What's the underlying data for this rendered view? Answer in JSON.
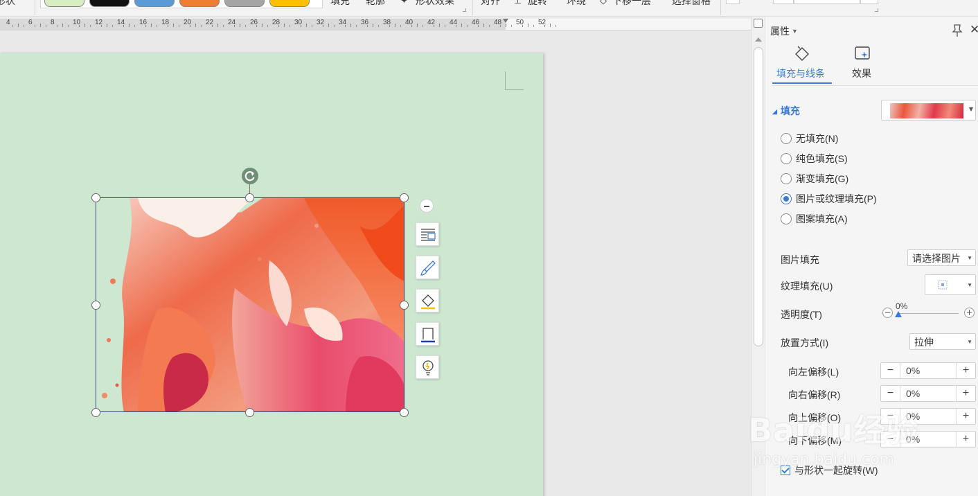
{
  "toolbar": {
    "shape_label": "形状",
    "fill_label": "填充",
    "outline_label": "轮廓",
    "effect_label": "形状效果",
    "align_label": "对齐",
    "rotate_label": "旋转",
    "wrap_label": "环绕",
    "down_label": "下移一层",
    "select_label": "选择窗格",
    "swatch_colors": [
      "#d7eec3",
      "#111111",
      "#5b9bd5",
      "#ed7d31",
      "#a5a5a5",
      "#ffc000"
    ]
  },
  "ruler": {
    "labels": [
      "4",
      "6",
      "8",
      "10",
      "12",
      "14",
      "16",
      "18",
      "20",
      "22",
      "24",
      "26",
      "28",
      "30",
      "32",
      "34",
      "36",
      "38",
      "40",
      "42",
      "44",
      "46",
      "48",
      "50",
      "52"
    ]
  },
  "float_tools": {
    "icons": [
      "layout-options-icon",
      "brush-icon",
      "fill-bucket-icon",
      "border-icon",
      "bulb-icon"
    ]
  },
  "panel": {
    "title": "属性",
    "tabs": [
      {
        "label": "填充与线条",
        "icon": "fill-line-icon",
        "active": true
      },
      {
        "label": "效果",
        "icon": "effect-icon",
        "active": false
      }
    ],
    "fill_section": {
      "heading": "填充",
      "options": [
        {
          "label": "无填充(N)",
          "checked": false
        },
        {
          "label": "纯色填充(S)",
          "checked": false
        },
        {
          "label": "渐变填充(G)",
          "checked": false
        },
        {
          "label": "图片或纹理填充(P)",
          "checked": true
        },
        {
          "label": "图案填充(A)",
          "checked": false
        }
      ],
      "picture_fill_label": "图片填充",
      "picture_fill_value": "请选择图片",
      "texture_fill_label": "纹理填充(U)",
      "transparency_label": "透明度(T)",
      "transparency_value": "0%",
      "transparency_minus": "−",
      "transparency_plus": "+",
      "placement_label": "放置方式(I)",
      "placement_value": "拉伸",
      "offsets": [
        {
          "label": "向左偏移(L)",
          "value": "0%"
        },
        {
          "label": "向右偏移(R)",
          "value": "0%"
        },
        {
          "label": "向上偏移(O)",
          "value": "0%"
        },
        {
          "label": "向下偏移(M)",
          "value": "0%"
        }
      ],
      "spin_minus": "−",
      "spin_plus": "+",
      "rotate_with_shape_label": "与形状一起旋转(W)",
      "rotate_with_shape_checked": true
    }
  },
  "watermark": {
    "brand": "Baidu经验",
    "url": "jingyan.baidu.com"
  },
  "colors": {
    "page_bg": "#cde7d0",
    "accent": "#3a7ad6"
  }
}
